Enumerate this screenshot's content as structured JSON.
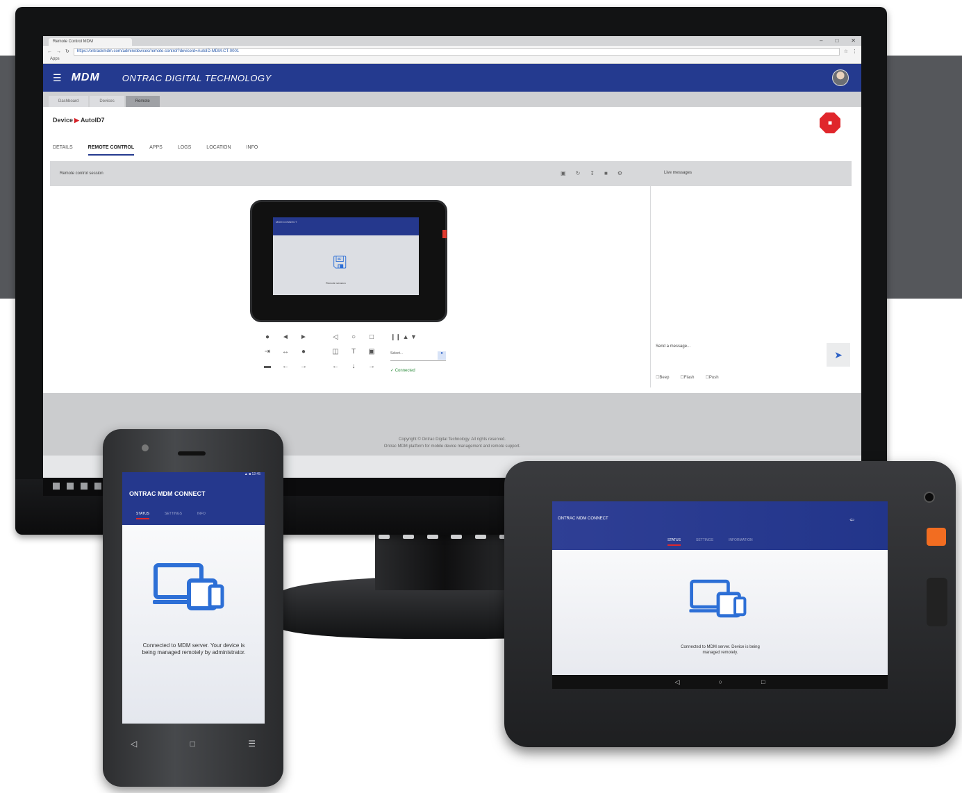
{
  "browser": {
    "tab_title": "Remote Control MDM",
    "url": "https://ontrackmdm.com/admin/devices/remote-control?deviceId=AutoID-MDM-CT-0001",
    "bookmarks": "Apps",
    "window_controls": [
      "–",
      "□",
      "✕"
    ]
  },
  "app": {
    "logo": "MDM",
    "title": "ONTRAC DIGITAL TECHNOLOGY",
    "subnav": [
      "Dashboard",
      "Devices",
      "Remote"
    ],
    "breadcrumb": {
      "root": "Device",
      "leaf": "AutoID7"
    },
    "tabs": [
      "DETAILS",
      "REMOTE CONTROL",
      "APPS",
      "LOGS",
      "LOCATION",
      "INFO"
    ],
    "toolbar_label": "Remote control session",
    "panel_title": "Live messages",
    "panel_input_label": "Send a message...",
    "panel_checks": [
      "Beep",
      "Flash",
      "Push"
    ],
    "controls": [
      "●",
      "◄",
      "►",
      "◁",
      "○",
      "□",
      "⇥",
      "↔",
      "●",
      "◫",
      "T",
      "▣",
      "▬",
      "←",
      "→",
      "←",
      "↓",
      "→"
    ],
    "media_controls": "❙❙  ▲  ▼",
    "select_value": "Select...",
    "check_text": "✓ Connected",
    "footer_lines": [
      "Copyright © Ontrac Digital Technology. All rights reserved.",
      "Ontrac MDM platform for mobile device management and remote support."
    ]
  },
  "preview": {
    "title": "MDM CONNECT",
    "text": "Remote session"
  },
  "phone": {
    "status": "▲ ■ 12:45",
    "title": "ONTRAC MDM CONNECT",
    "tabs": [
      "STATUS",
      "SETTINGS",
      "INFO"
    ],
    "message": "Connected to MDM server. Your device is being managed remotely by administrator.",
    "nav": [
      "◁",
      "□",
      "☰"
    ]
  },
  "tablet": {
    "title": "ONTRAC MDM CONNECT",
    "tabs": [
      "STATUS",
      "SETTINGS",
      "INFORMATION"
    ],
    "back": "⇦",
    "message": "Connected to MDM server. Device is being managed remotely.",
    "nav": [
      "◁",
      "○",
      "□"
    ]
  },
  "colors": {
    "brand_blue": "#243a8f",
    "accent_red": "#e0262b",
    "icon_blue": "#2d6fd6",
    "tablet_orange": "#f26d21"
  },
  "icons": [
    "menu-icon",
    "devices-icon",
    "send-icon",
    "avatar"
  ]
}
